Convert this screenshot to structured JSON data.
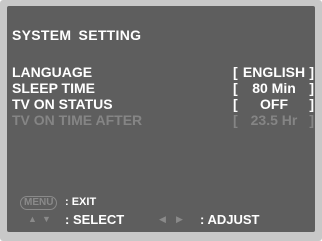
{
  "menu": {
    "title": "SYSTEM  SETTING",
    "items": [
      {
        "label": "LANGUAGE",
        "value": "ENGLISH",
        "enabled": true
      },
      {
        "label": "SLEEP TIME",
        "value": "80 Min",
        "enabled": true
      },
      {
        "label": "TV ON STATUS",
        "value": "OFF",
        "enabled": true
      },
      {
        "label": "TV ON TIME AFTER",
        "value": "23.5 Hr",
        "enabled": false
      }
    ],
    "bracket_open": "[",
    "bracket_close": "]"
  },
  "footer": {
    "menu_key": "MENU",
    "exit_label": ": EXIT",
    "select_label": ": SELECT",
    "adjust_label": ": ADJUST",
    "up_arrow": "▲",
    "down_arrow": "▼",
    "left_arrow": "◀",
    "right_arrow": "▶"
  },
  "colors": {
    "panel_bg": "#5e5e5e",
    "frame_bg": "#c8c8c8",
    "text": "#ffffff",
    "disabled_text": "#858585"
  }
}
